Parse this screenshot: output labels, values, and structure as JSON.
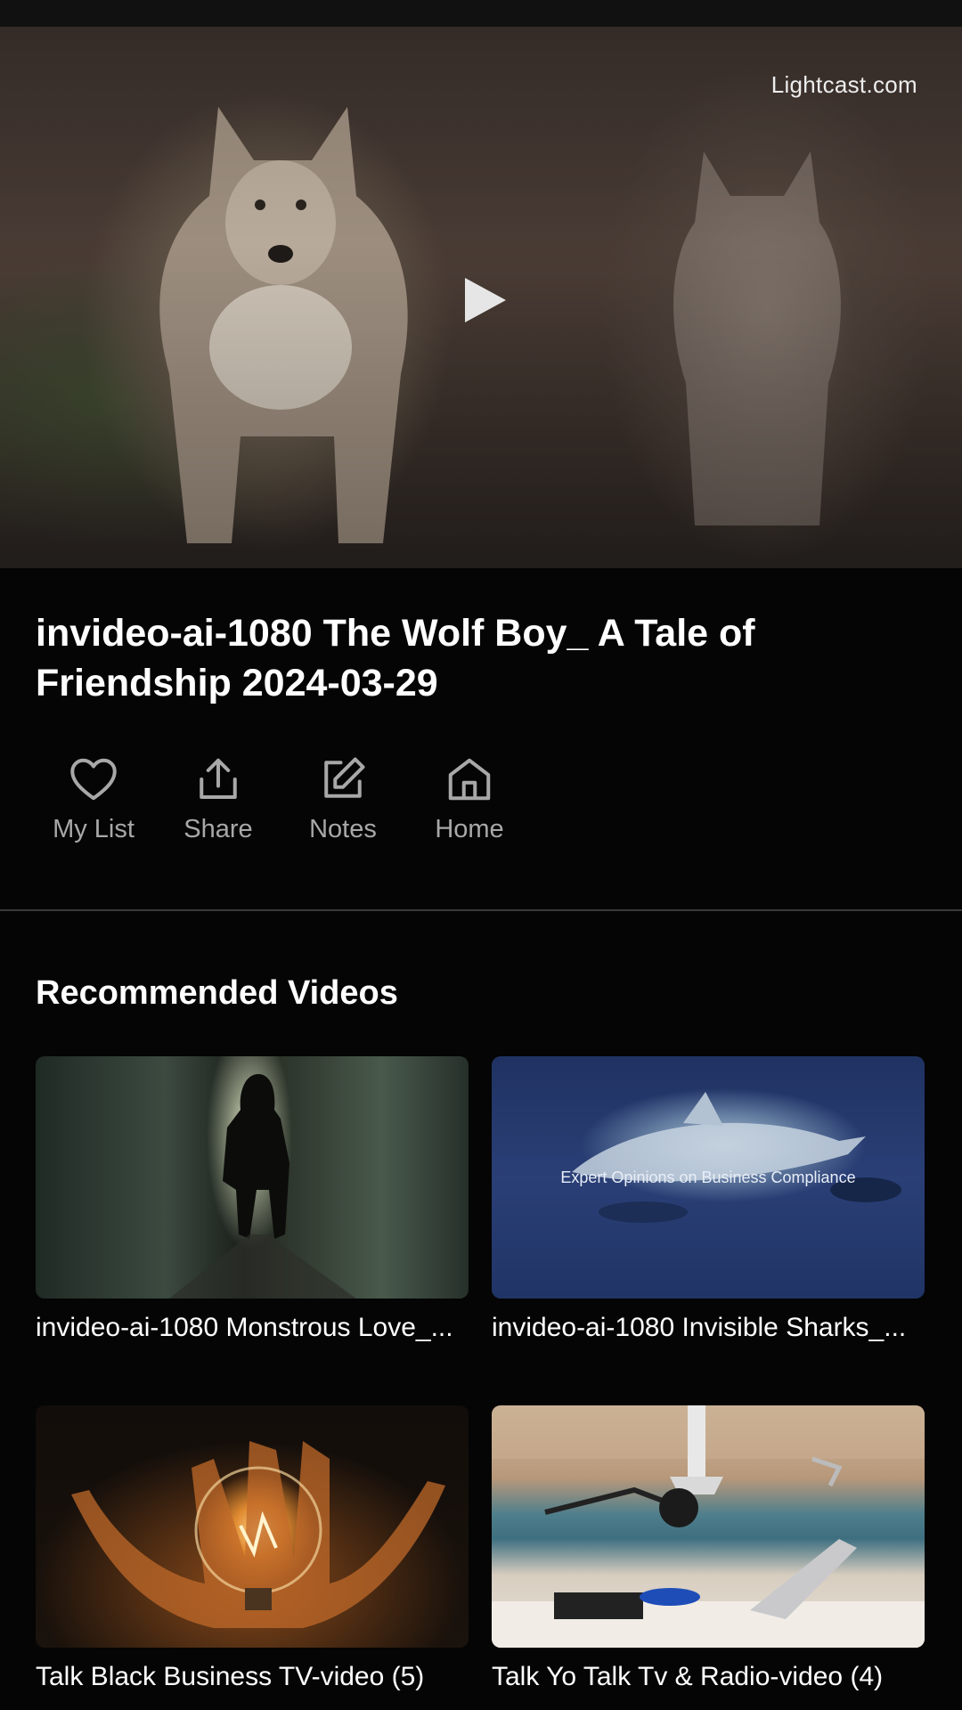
{
  "player": {
    "watermark": "Lightcast.com",
    "play_icon": "play-icon"
  },
  "video": {
    "title": "invideo-ai-1080 The Wolf Boy_ A Tale of Friendship 2024-03-29"
  },
  "actions": [
    {
      "label": "My List",
      "icon": "heart-icon"
    },
    {
      "label": "Share",
      "icon": "share-icon"
    },
    {
      "label": "Notes",
      "icon": "edit-icon"
    },
    {
      "label": "Home",
      "icon": "home-icon"
    }
  ],
  "recommended": {
    "title": "Recommended Videos",
    "items": [
      {
        "title": "invideo-ai-1080 Monstrous Love_...",
        "thumb_text": ""
      },
      {
        "title": "invideo-ai-1080 Invisible Sharks_...",
        "thumb_text": "Expert Opinions on Business Compliance"
      },
      {
        "title": "Talk Black Business TV-video (5)",
        "thumb_text": ""
      },
      {
        "title": "Talk Yo Talk Tv & Radio-video (4)",
        "thumb_text": ""
      }
    ]
  },
  "colors": {
    "background": "#050505",
    "text_primary": "#ffffff",
    "text_secondary": "#a8a8a8",
    "divider": "#3a3a3a"
  }
}
